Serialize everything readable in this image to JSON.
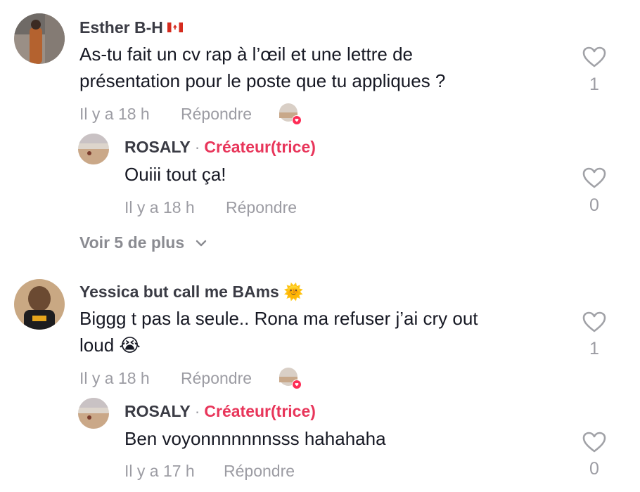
{
  "comments": [
    {
      "author": "Esther B-H",
      "flag": "canada-flag",
      "text_line1": "As-tu fait un cv rap à l’œil et une lettre de",
      "text_line2": "présentation pour le poste que tu appliques ?",
      "time": "Il y a 18 h",
      "reply_label": "Répondre",
      "likes": "1",
      "reply": {
        "author": "ROSALY",
        "sep": "·",
        "badge": "Créateur(trice)",
        "text": "Ouiii tout ça!",
        "time": "Il y a 18 h",
        "reply_label": "Répondre",
        "likes": "0"
      },
      "more": "Voir 5 de plus"
    },
    {
      "author": "Yessica but call me BAms",
      "emoji": "🌞",
      "text_line1": "Biggg t pas la seule.. Rona ma refuser j’ai cry out",
      "text_line2": "loud 😭",
      "time": "Il y a 18 h",
      "reply_label": "Répondre",
      "likes": "1",
      "reply": {
        "author": "ROSALY",
        "sep": "·",
        "badge": "Créateur(trice)",
        "text": "Ben voyonnnnnnnsss hahahaha",
        "time": "Il y a 17 h",
        "reply_label": "Répondre",
        "likes": "0"
      }
    }
  ],
  "colors": {
    "creator": "#e8355a",
    "muted": "#9c9ca3",
    "text": "#161823"
  }
}
